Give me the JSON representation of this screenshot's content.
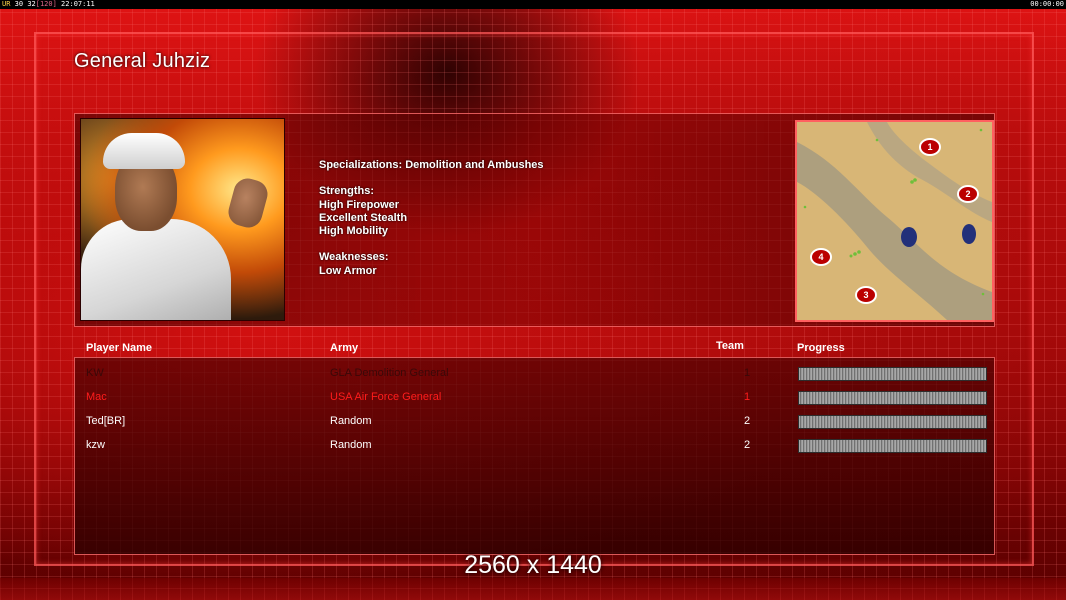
{
  "hud": {
    "left_tag": "UR",
    "num1": "30",
    "num2": "32",
    "bracket": "[120]",
    "clock": "22:07:11",
    "right_clock": "00:00:00"
  },
  "general": {
    "title": "General Juhziz",
    "specializations": "Specializations: Demolition and Ambushes",
    "strengths_heading": "Strengths:",
    "strengths": [
      "High Firepower",
      "Excellent Stealth",
      "High Mobility"
    ],
    "weaknesses_heading": "Weaknesses:",
    "weaknesses": [
      "Low Armor"
    ]
  },
  "minimap": {
    "start_positions": [
      "1",
      "2",
      "3",
      "4"
    ]
  },
  "table": {
    "headers": {
      "player_name": "Player Name",
      "army": "Army",
      "team": "Team",
      "progress": "Progress"
    },
    "rows": [
      {
        "name": "KW",
        "army": "GLA Demolition General",
        "team": "1",
        "progress": 1.0,
        "color": "#3a0808"
      },
      {
        "name": "Mac",
        "army": "USA Air Force General",
        "team": "1",
        "progress": 1.0,
        "color": "#ff1c1c"
      },
      {
        "name": "Ted[BR]",
        "army": "Random",
        "team": "2",
        "progress": 1.0,
        "color": "#ffffff"
      },
      {
        "name": "kzw",
        "army": "Random",
        "team": "2",
        "progress": 1.0,
        "color": "#ffffff"
      }
    ]
  },
  "footer": {
    "resolution": "2560 x 1440"
  }
}
